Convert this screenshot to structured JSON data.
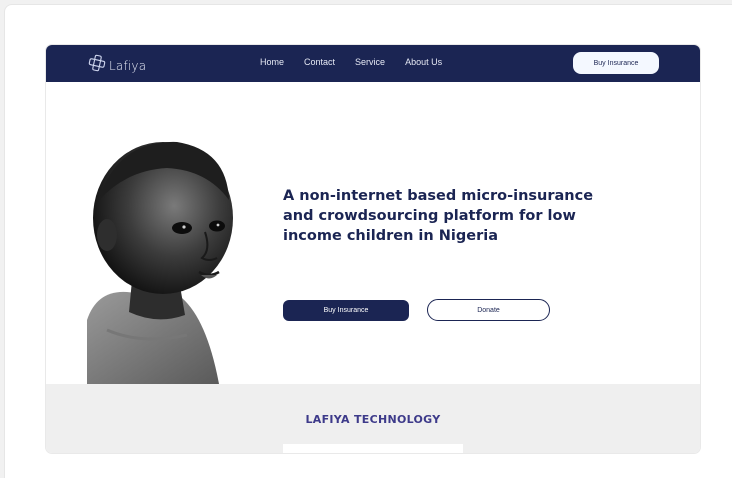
{
  "brand": {
    "name": "Lafiya",
    "logo_icon": "medical-cross-outline-icon"
  },
  "nav": {
    "links": [
      "Home",
      "Contact",
      "Service",
      "About Us"
    ],
    "cta_label": "Buy Insurance"
  },
  "hero": {
    "headline": "A non-internet based micro-insurance and crowdsourcing platform for low income children in Nigeria",
    "primary_button": "Buy Insurance",
    "secondary_button": "Donate",
    "image": "child-portrait-photo"
  },
  "section": {
    "title": "LAFIYA TECHNOLOGY"
  },
  "colors": {
    "navy": "#1b2553",
    "accent_purple": "#3d3a8a",
    "light_gray": "#efefef"
  }
}
